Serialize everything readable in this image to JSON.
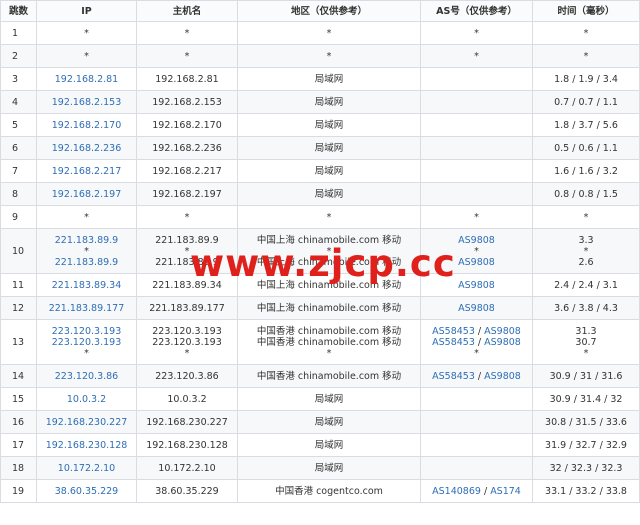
{
  "headers": [
    "跳数",
    "IP",
    "主机名",
    "地区（仅供参考）",
    "AS号（仅供参考）",
    "时间（毫秒）"
  ],
  "rows": [
    {
      "hop": "1",
      "ip": [
        "*"
      ],
      "host": [
        "*"
      ],
      "region": [
        "*"
      ],
      "as": [
        [
          "*"
        ]
      ],
      "time": [
        "*"
      ]
    },
    {
      "hop": "2",
      "ip": [
        "*"
      ],
      "host": [
        "*"
      ],
      "region": [
        "*"
      ],
      "as": [
        [
          "*"
        ]
      ],
      "time": [
        "*"
      ]
    },
    {
      "hop": "3",
      "ip": [
        "192.168.2.81"
      ],
      "host": [
        "192.168.2.81"
      ],
      "region": [
        "局域网"
      ],
      "as": [
        []
      ],
      "time": [
        "1.8 / 1.9 / 3.4"
      ]
    },
    {
      "hop": "4",
      "ip": [
        "192.168.2.153"
      ],
      "host": [
        "192.168.2.153"
      ],
      "region": [
        "局域网"
      ],
      "as": [
        []
      ],
      "time": [
        "0.7 / 0.7 / 1.1"
      ]
    },
    {
      "hop": "5",
      "ip": [
        "192.168.2.170"
      ],
      "host": [
        "192.168.2.170"
      ],
      "region": [
        "局域网"
      ],
      "as": [
        []
      ],
      "time": [
        "1.8 / 3.7 / 5.6"
      ]
    },
    {
      "hop": "6",
      "ip": [
        "192.168.2.236"
      ],
      "host": [
        "192.168.2.236"
      ],
      "region": [
        "局域网"
      ],
      "as": [
        []
      ],
      "time": [
        "0.5 / 0.6 / 1.1"
      ]
    },
    {
      "hop": "7",
      "ip": [
        "192.168.2.217"
      ],
      "host": [
        "192.168.2.217"
      ],
      "region": [
        "局域网"
      ],
      "as": [
        []
      ],
      "time": [
        "1.6 / 1.6 / 3.2"
      ]
    },
    {
      "hop": "8",
      "ip": [
        "192.168.2.197"
      ],
      "host": [
        "192.168.2.197"
      ],
      "region": [
        "局域网"
      ],
      "as": [
        []
      ],
      "time": [
        "0.8 / 0.8 / 1.5"
      ]
    },
    {
      "hop": "9",
      "ip": [
        "*"
      ],
      "host": [
        "*"
      ],
      "region": [
        "*"
      ],
      "as": [
        [
          "*"
        ]
      ],
      "time": [
        "*"
      ]
    },
    {
      "hop": "10",
      "ip": [
        "221.183.89.9",
        "*",
        "221.183.89.9"
      ],
      "host": [
        "221.183.89.9",
        "*",
        "221.183.89.9"
      ],
      "region": [
        "中国上海 chinamobile.com 移动",
        "*",
        "中国上海 chinamobile.com 移动"
      ],
      "as": [
        [
          "AS9808"
        ],
        [
          "*"
        ],
        [
          "AS9808"
        ]
      ],
      "time": [
        "3.3",
        "*",
        "2.6"
      ]
    },
    {
      "hop": "11",
      "ip": [
        "221.183.89.34"
      ],
      "host": [
        "221.183.89.34"
      ],
      "region": [
        "中国上海 chinamobile.com 移动"
      ],
      "as": [
        [
          "AS9808"
        ]
      ],
      "time": [
        "2.4 / 2.4 / 3.1"
      ]
    },
    {
      "hop": "12",
      "ip": [
        "221.183.89.177"
      ],
      "host": [
        "221.183.89.177"
      ],
      "region": [
        "中国上海 chinamobile.com 移动"
      ],
      "as": [
        [
          "AS9808"
        ]
      ],
      "time": [
        "3.6 / 3.8 / 4.3"
      ]
    },
    {
      "hop": "13",
      "ip": [
        "223.120.3.193",
        "223.120.3.193",
        "*"
      ],
      "host": [
        "223.120.3.193",
        "223.120.3.193",
        "*"
      ],
      "region": [
        "中国香港 chinamobile.com 移动",
        "中国香港 chinamobile.com 移动",
        "*"
      ],
      "as": [
        [
          "AS58453",
          "AS9808"
        ],
        [
          "AS58453",
          "AS9808"
        ],
        [
          "*"
        ]
      ],
      "time": [
        "31.3",
        "30.7",
        "*"
      ]
    },
    {
      "hop": "14",
      "ip": [
        "223.120.3.86"
      ],
      "host": [
        "223.120.3.86"
      ],
      "region": [
        "中国香港 chinamobile.com 移动"
      ],
      "as": [
        [
          "AS58453",
          "AS9808"
        ]
      ],
      "time": [
        "30.9 / 31 / 31.6"
      ]
    },
    {
      "hop": "15",
      "ip": [
        "10.0.3.2"
      ],
      "host": [
        "10.0.3.2"
      ],
      "region": [
        "局域网"
      ],
      "as": [
        []
      ],
      "time": [
        "30.9 / 31.4 / 32"
      ]
    },
    {
      "hop": "16",
      "ip": [
        "192.168.230.227"
      ],
      "host": [
        "192.168.230.227"
      ],
      "region": [
        "局域网"
      ],
      "as": [
        []
      ],
      "time": [
        "30.8 / 31.5 / 33.6"
      ]
    },
    {
      "hop": "17",
      "ip": [
        "192.168.230.128"
      ],
      "host": [
        "192.168.230.128"
      ],
      "region": [
        "局域网"
      ],
      "as": [
        []
      ],
      "time": [
        "31.9 / 32.7 / 32.9"
      ]
    },
    {
      "hop": "18",
      "ip": [
        "10.172.2.10"
      ],
      "host": [
        "10.172.2.10"
      ],
      "region": [
        "局域网"
      ],
      "as": [
        []
      ],
      "time": [
        "32 / 32.3 / 32.3"
      ]
    },
    {
      "hop": "19",
      "ip": [
        "38.60.35.229"
      ],
      "host": [
        "38.60.35.229"
      ],
      "region": [
        "中国香港 cogentco.com"
      ],
      "as": [
        [
          "AS140869",
          "AS174"
        ]
      ],
      "time": [
        "33.1 / 33.2 / 33.8"
      ]
    }
  ],
  "watermark": "www.zjcp.cc"
}
